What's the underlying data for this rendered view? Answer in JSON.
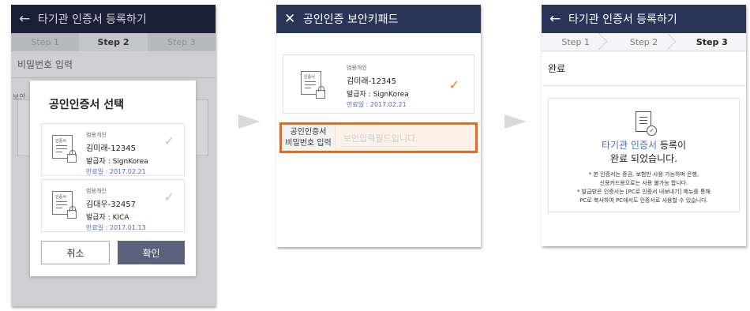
{
  "screen1": {
    "back_icon": "back-arrow-icon",
    "title": "타기관 인증서 등록하기",
    "steps": [
      "Step 1",
      "Step 2",
      "Step 3"
    ],
    "active_step": 2,
    "section_label": "비밀번호 입력",
    "bg_fragment": "보안",
    "dialog": {
      "title": "공인인증서 선택",
      "certs": [
        {
          "type": "범용개인",
          "name": "김미래-12345",
          "issuer": "발급자 : SignKorea",
          "expiry": "만료일 : 2017.02.21"
        },
        {
          "type": "범용개인",
          "name": "김대우-32457",
          "issuer": "발급자 : KICA",
          "expiry": "만료일 : 2017.01.13"
        }
      ],
      "cancel_label": "취소",
      "ok_label": "확인"
    }
  },
  "screen2": {
    "close_icon": "close-icon",
    "title": "공인인증 보안키패드",
    "cert": {
      "type": "범용개인",
      "name": "김미래-12345",
      "issuer": "발급자 : SignKorea",
      "expiry": "만료일 : 2017.02.21"
    },
    "password_label_line1": "공인인증서",
    "password_label_line2": "비밀번호 입력",
    "password_placeholder": "보안입력필드입니다."
  },
  "screen3": {
    "back_icon": "back-arrow-icon",
    "title": "타기관 인증서 등록하기",
    "steps": [
      "Step 1",
      "Step 2",
      "Step 3"
    ],
    "active_step": 3,
    "done_label": "완료",
    "msg_highlight": "타기관 인증서",
    "msg_rest": " 등록이",
    "msg_line2": "완료 되었습니다.",
    "note1": "* 본 인증서는 증권, 보험만 사용 가능하며 은행,",
    "note2": "신용카드용으로는 사용 불가능 합니다.",
    "note3": "* 발급받은 인증서는 [PC로 인증서 내보내기] 메뉴를 통해",
    "note4": "PC로 복사하여 PC에서도 인증서로 사용할 수 있습니다."
  },
  "cert_icon_label": "인증서",
  "colors": {
    "header": "#2b3558",
    "accent_orange": "#e56a1e",
    "link_blue": "#4a6bc6"
  }
}
